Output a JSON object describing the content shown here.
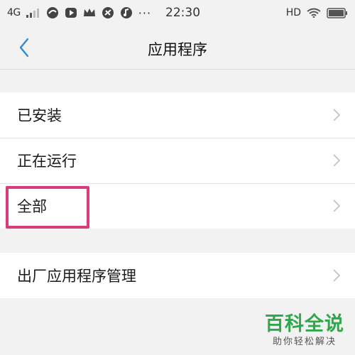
{
  "status_bar": {
    "network": "4G",
    "time": "22:30",
    "hd": "HD",
    "more": "···"
  },
  "header": {
    "title": "应用程序"
  },
  "menu_groups": [
    {
      "items": [
        {
          "label": "已安装"
        },
        {
          "label": "正在运行"
        },
        {
          "label": "全部"
        }
      ]
    },
    {
      "items": [
        {
          "label": "出厂应用程序管理"
        }
      ]
    }
  ],
  "watermark": {
    "title": "百科全说",
    "subtitle": "助你轻松解决"
  },
  "colors": {
    "accent": "#2f8bd6",
    "highlight": "#d93c7a",
    "watermark": "#2ea84a"
  }
}
